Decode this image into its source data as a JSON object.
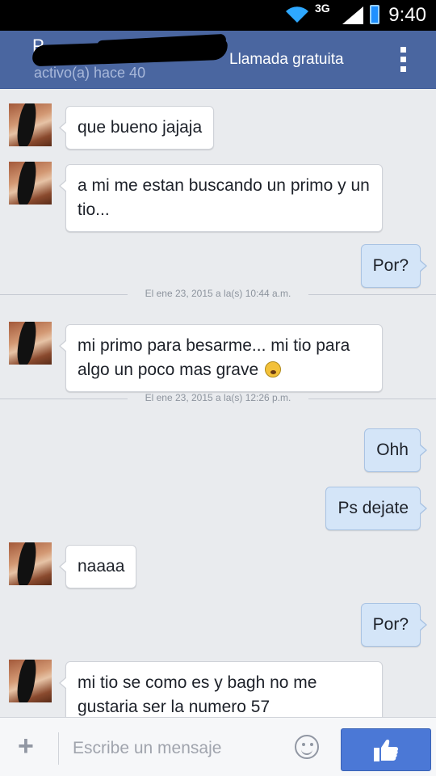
{
  "status_bar": {
    "network": "3G",
    "time": "9:40"
  },
  "header": {
    "contact_name": "P",
    "status": "activo(a) hace 40",
    "call_label": "Llamada gratuita"
  },
  "messages": [
    {
      "direction": "in",
      "text": "que bueno jajaja"
    },
    {
      "direction": "in",
      "text": "a mi me estan buscando un primo y un tio..."
    },
    {
      "direction": "out",
      "text": "Por?"
    },
    {
      "type": "timestamp",
      "text": "El ene 23, 2015 a la(s) 10:44 a.m."
    },
    {
      "direction": "in",
      "text": "mi primo para besarme... mi tio para algo un poco mas grave"
    },
    {
      "type": "timestamp",
      "text": "El ene 23, 2015 a la(s) 12:26 p.m."
    },
    {
      "direction": "out",
      "text": "Ohh"
    },
    {
      "direction": "out",
      "text": "Ps dejate"
    },
    {
      "direction": "in",
      "text": "naaaa"
    },
    {
      "direction": "out",
      "text": "Por?"
    },
    {
      "direction": "in",
      "text": "mi tio se como es y bagh no me gustaria ser la numero 57"
    }
  ],
  "composer": {
    "placeholder": "Escribe un mensaje",
    "like_icon": "thumbs-up-icon",
    "add_icon": "plus-icon",
    "emoji_icon": "smiley-icon"
  },
  "colors": {
    "header_bg": "#4a66a0",
    "outgoing_bubble": "#d4e5f8",
    "incoming_bubble": "#ffffff",
    "like_button": "#4b78d6"
  }
}
